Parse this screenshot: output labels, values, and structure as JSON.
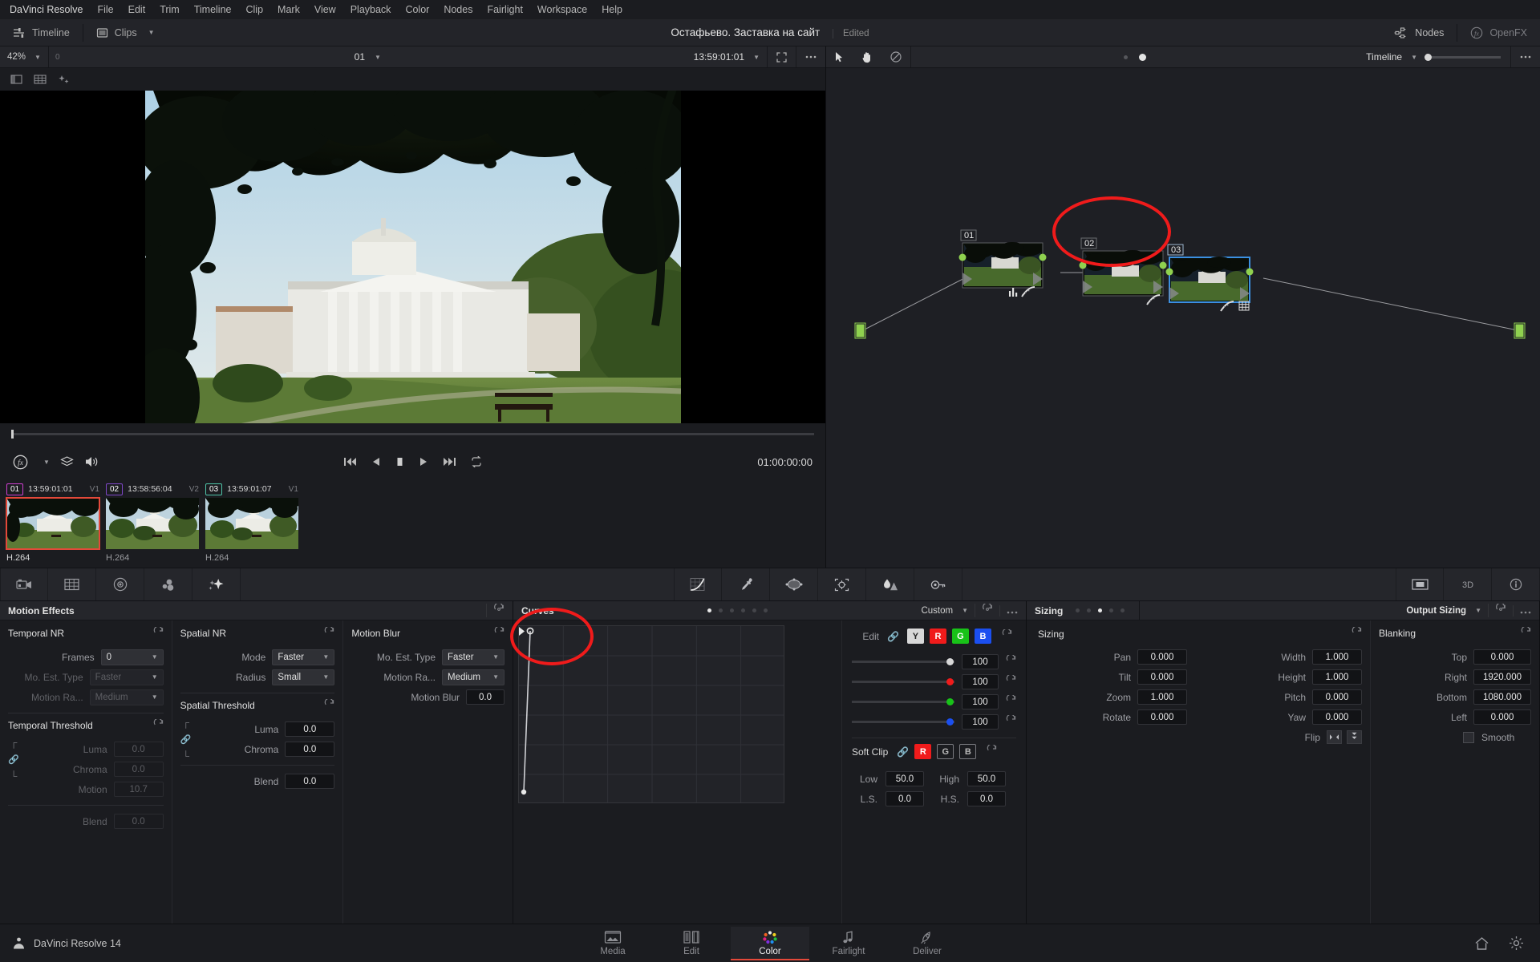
{
  "menubar": {
    "items": [
      "DaVinci Resolve",
      "File",
      "Edit",
      "Trim",
      "Timeline",
      "Clip",
      "Mark",
      "View",
      "Playback",
      "Color",
      "Nodes",
      "Fairlight",
      "Workspace",
      "Help"
    ]
  },
  "titlebar": {
    "timeline_label": "Timeline",
    "clips_label": "Clips",
    "project_title": "Остафьево. Заставка на сайт",
    "edited_label": "Edited",
    "nodes_label": "Nodes",
    "openfx_label": "OpenFX"
  },
  "viewer": {
    "zoom": "42%",
    "left_small": "0",
    "clip_selector": "01",
    "timecode": "13:59:01:01",
    "current_timecode": "01:00:00:00"
  },
  "node_view": {
    "tool_label": "Timeline",
    "nodes": [
      {
        "number": "01",
        "selected": false,
        "badges": [
          "histogram-icon",
          "curve-icon"
        ]
      },
      {
        "number": "02",
        "selected": false,
        "badges": [
          "curve-icon"
        ]
      },
      {
        "number": "03",
        "selected": true,
        "badges": [
          "curve-icon",
          "grid-icon"
        ]
      }
    ]
  },
  "clips": [
    {
      "number": "01",
      "timecode": "13:59:01:01",
      "track": "V1",
      "codec": "H.264",
      "selected": true
    },
    {
      "number": "02",
      "timecode": "13:58:56:04",
      "track": "V2",
      "codec": "H.264",
      "selected": false
    },
    {
      "number": "03",
      "timecode": "13:59:01:07",
      "track": "V1",
      "codec": "H.264",
      "selected": false
    }
  ],
  "palette_bar": {
    "left_icons": [
      "camera-raw-icon",
      "color-match-icon",
      "color-wheels-icon",
      "primaries-icon",
      "rgb-mixer-icon"
    ],
    "center_icons": [
      "curves-icon",
      "qualifier-icon",
      "power-window-icon",
      "tracker-icon",
      "blur-icon",
      "key-icon"
    ],
    "right_icons": [
      "sizing-icon",
      "stereo-3d-icon",
      "data-burn-icon"
    ]
  },
  "motion_effects": {
    "title": "Motion Effects",
    "temporal_nr": {
      "title": "Temporal NR",
      "frames_label": "Frames",
      "frames_value": "0",
      "mo_est_label": "Mo. Est. Type",
      "mo_est_value": "Faster",
      "motion_range_label": "Motion Ra...",
      "motion_range_value": "Medium"
    },
    "temporal_threshold": {
      "title": "Temporal Threshold",
      "luma_label": "Luma",
      "luma_value": "0.0",
      "chroma_label": "Chroma",
      "chroma_value": "0.0",
      "motion_label": "Motion",
      "motion_value": "10.7",
      "blend_label": "Blend",
      "blend_value": "0.0"
    },
    "spatial_nr": {
      "title": "Spatial NR",
      "mode_label": "Mode",
      "mode_value": "Faster",
      "radius_label": "Radius",
      "radius_value": "Small"
    },
    "spatial_threshold": {
      "title": "Spatial Threshold",
      "luma_label": "Luma",
      "luma_value": "0.0",
      "chroma_label": "Chroma",
      "chroma_value": "0.0",
      "blend_label": "Blend",
      "blend_value": "0.0"
    },
    "motion_blur": {
      "title": "Motion Blur",
      "mo_est_label": "Mo. Est. Type",
      "mo_est_value": "Faster",
      "motion_range_label": "Motion Ra...",
      "motion_range_value": "Medium",
      "motion_blur_label": "Motion Blur",
      "motion_blur_value": "0.0"
    }
  },
  "curves": {
    "title": "Curves",
    "mode": "Custom",
    "edit_label": "Edit",
    "channels": [
      {
        "label": "Y",
        "color": "#d8d8d8",
        "text": "#222222",
        "active": true
      },
      {
        "label": "R",
        "color": "#f01b1b",
        "text": "#ffffff",
        "active": true
      },
      {
        "label": "G",
        "color": "#18c218",
        "text": "#ffffff",
        "active": true
      },
      {
        "label": "B",
        "color": "#1b4ff0",
        "text": "#ffffff",
        "active": true
      }
    ],
    "sliders": [
      {
        "name": "y",
        "value": "100",
        "color": "#d8d8d8",
        "pct": 92
      },
      {
        "name": "r",
        "value": "100",
        "color": "#f01b1b",
        "pct": 92
      },
      {
        "name": "g",
        "value": "100",
        "color": "#18c218",
        "pct": 92
      },
      {
        "name": "b",
        "value": "100",
        "color": "#1b4ff0",
        "pct": 92
      }
    ],
    "soft_clip": {
      "title": "Soft Clip",
      "channels": [
        {
          "label": "R",
          "color": "#f01b1b",
          "text": "#ffffff",
          "active": true
        },
        {
          "label": "G",
          "color": "transparent",
          "text": "#b9b9b9",
          "active": false
        },
        {
          "label": "B",
          "color": "transparent",
          "text": "#b9b9b9",
          "active": false
        }
      ],
      "low_label": "Low",
      "low_value": "50.0",
      "high_label": "High",
      "high_value": "50.0",
      "ls_label": "L.S.",
      "ls_value": "0.0",
      "hs_label": "H.S.",
      "hs_value": "0.0"
    }
  },
  "sizing": {
    "title": "Sizing",
    "section_title": "Sizing",
    "left": [
      {
        "label": "Pan",
        "value": "0.000"
      },
      {
        "label": "Tilt",
        "value": "0.000"
      },
      {
        "label": "Zoom",
        "value": "1.000"
      },
      {
        "label": "Rotate",
        "value": "0.000"
      }
    ],
    "right": [
      {
        "label": "Width",
        "value": "1.000"
      },
      {
        "label": "Height",
        "value": "1.000"
      },
      {
        "label": "Pitch",
        "value": "0.000"
      },
      {
        "label": "Yaw",
        "value": "0.000"
      },
      {
        "label": "Flip",
        "value": ""
      }
    ]
  },
  "output_sizing": {
    "title": "Output Sizing",
    "section_title": "Blanking",
    "fields": [
      {
        "label": "Top",
        "value": "0.000"
      },
      {
        "label": "Right",
        "value": "1920.000"
      },
      {
        "label": "Bottom",
        "value": "1080.000"
      },
      {
        "label": "Left",
        "value": "0.000"
      }
    ],
    "smooth_label": "Smooth"
  },
  "statusbar": {
    "app_version": "DaVinci Resolve 14",
    "pages": [
      {
        "label": "Media",
        "icon": "media-icon",
        "active": false
      },
      {
        "label": "Edit",
        "icon": "edit-icon",
        "active": false
      },
      {
        "label": "Color",
        "icon": "color-icon",
        "active": true
      },
      {
        "label": "Fairlight",
        "icon": "fairlight-icon",
        "active": false
      },
      {
        "label": "Deliver",
        "icon": "deliver-icon",
        "active": false
      }
    ],
    "right_icons": [
      "home-icon",
      "settings-icon"
    ]
  },
  "colors": {
    "accent": "#e4493a",
    "annotation": "#f01b1b",
    "panel_bg": "#1b1c20",
    "header_bg": "#25262b",
    "node_selected": "#3b8fe0"
  }
}
